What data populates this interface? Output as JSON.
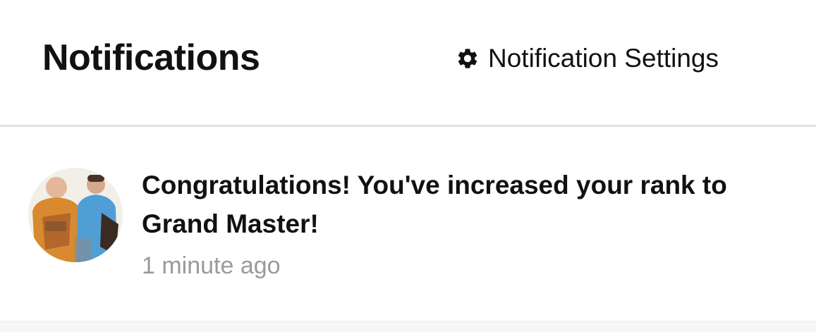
{
  "header": {
    "title": "Notifications",
    "settings_label": "Notification Settings",
    "settings_icon": "gear-icon"
  },
  "notifications": [
    {
      "message": "Congratulations! You've increased your rank to Grand Master!",
      "time": "1 minute ago",
      "avatar": "avatar-photo"
    }
  ],
  "colors": {
    "text": "#111111",
    "muted": "#9a9a9e",
    "divider": "#e1e1e4",
    "background": "#ffffff"
  }
}
